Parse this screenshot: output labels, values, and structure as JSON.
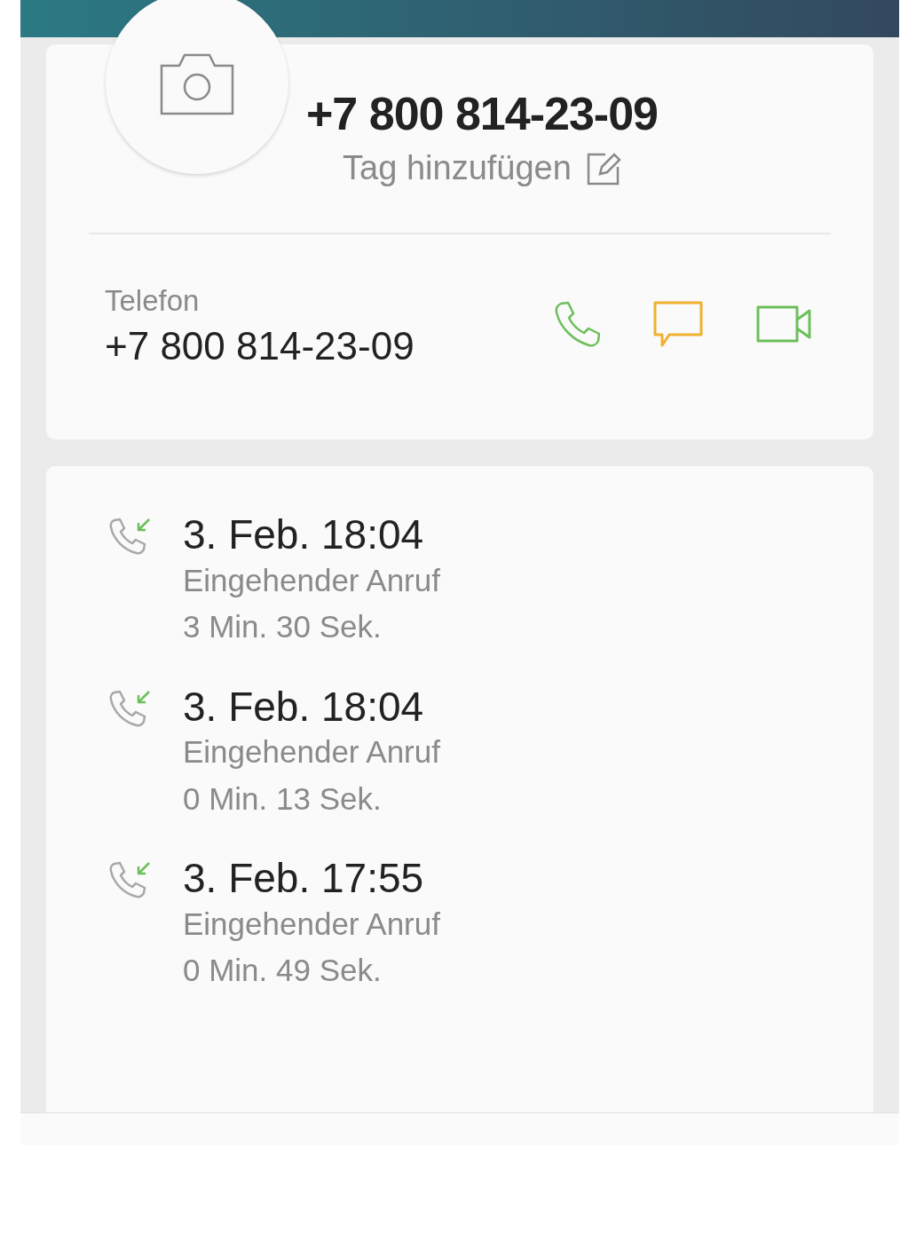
{
  "contact": {
    "number": "+7 800 814-23-09",
    "tag_link": "Tag hinzufügen"
  },
  "phone": {
    "label": "Telefon",
    "number": "+7 800 814-23-09"
  },
  "calls": [
    {
      "kind": "incoming",
      "date": "3. Feb. 18:04",
      "type": "Eingehender Anruf",
      "duration": "3 Min. 30 Sek."
    },
    {
      "kind": "incoming",
      "date": "3. Feb. 18:04",
      "type": "Eingehender Anruf",
      "duration": "0 Min. 13 Sek."
    },
    {
      "kind": "incoming",
      "date": "3. Feb. 17:55",
      "type": "Eingehender Anruf",
      "duration": "0 Min. 49 Sek."
    }
  ]
}
